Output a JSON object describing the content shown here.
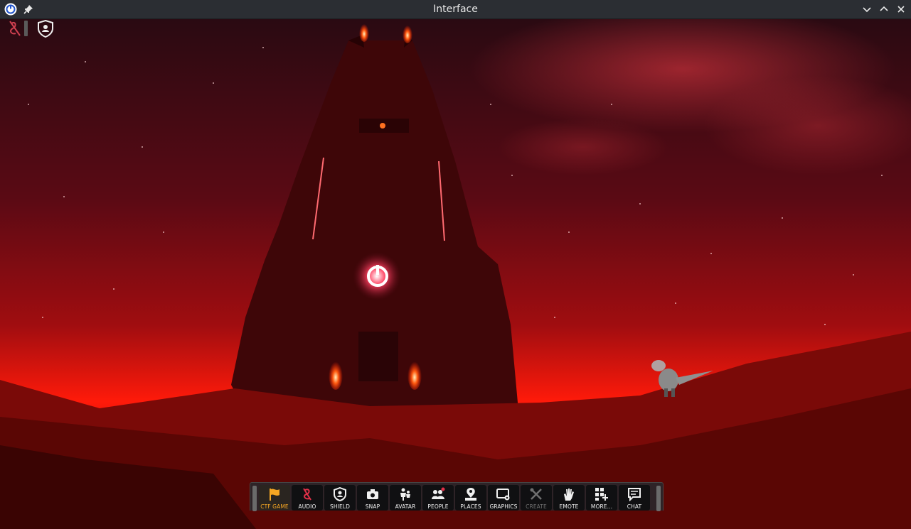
{
  "window": {
    "title": "Interface"
  },
  "colors": {
    "titlebar": "#2b2e33",
    "active_label": "#f5a623",
    "sky": "#c01010"
  },
  "hud": {
    "icons": [
      "mute-audio-icon",
      "shield-bubble-icon"
    ]
  },
  "toolbar": {
    "buttons": [
      {
        "label": "CTF GAME",
        "icon": "flag-icon",
        "state": "active"
      },
      {
        "label": "AUDIO",
        "icon": "audio-muted-icon",
        "state": "normal"
      },
      {
        "label": "SHIELD",
        "icon": "shield-icon",
        "state": "normal"
      },
      {
        "label": "SNAP",
        "icon": "camera-icon",
        "state": "normal"
      },
      {
        "label": "AVATAR",
        "icon": "avatar-icon",
        "state": "normal"
      },
      {
        "label": "PEOPLE",
        "icon": "people-icon",
        "state": "normal"
      },
      {
        "label": "PLACES",
        "icon": "places-icon",
        "state": "normal"
      },
      {
        "label": "GRAPHICS",
        "icon": "graphics-icon",
        "state": "normal"
      },
      {
        "label": "CREATE",
        "icon": "create-tools-icon",
        "state": "disabled"
      },
      {
        "label": "EMOTE",
        "icon": "hand-wave-icon",
        "state": "normal"
      },
      {
        "label": "MORE...",
        "icon": "more-apps-icon",
        "state": "normal"
      },
      {
        "label": "CHAT",
        "icon": "chat-bubble-icon",
        "state": "normal"
      }
    ]
  }
}
